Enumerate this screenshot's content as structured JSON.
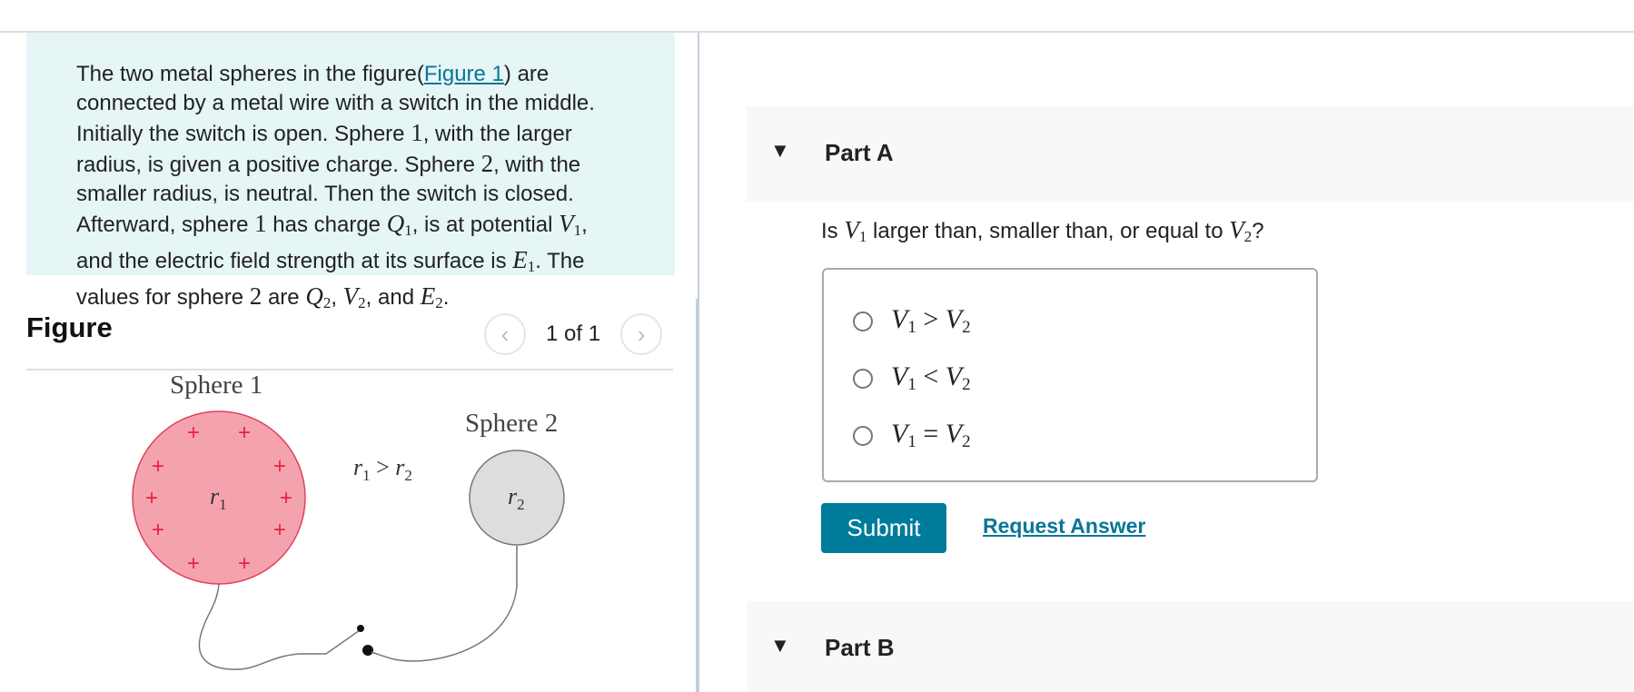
{
  "problem": {
    "lines": [
      {
        "pre": "The two metal spheres in the figure(",
        "link": "Figure 1",
        "post": ") are"
      },
      {
        "text": "connected by a metal wire with a switch in the middle."
      },
      {
        "text_a": "Initially the switch is open. Sphere ",
        "num": "1",
        "text_b": ", with the larger"
      },
      {
        "text_a": "radius, is given a positive charge. Sphere ",
        "num": "2",
        "text_b": ", with the"
      },
      {
        "text": "smaller radius, is neutral. Then the switch is closed."
      },
      {
        "a": "Afterward, sphere ",
        "n1": "1",
        "b": " has charge ",
        "q": "Q",
        "qs": "1",
        "c": ", is at potential ",
        "v": "V",
        "vs": "1",
        "d": ","
      },
      {
        "a": "and the electric field strength at its surface is ",
        "e": "E",
        "es": "1",
        "b": ". The"
      },
      {
        "a": "values for sphere ",
        "n": "2",
        "b": " are ",
        "q": "Q",
        "qs": "2",
        "c": ", ",
        "v": "V",
        "vs": "2",
        "d": ", and ",
        "e": "E",
        "es": "2",
        "f": "."
      }
    ]
  },
  "figure": {
    "heading": "Figure",
    "pager": {
      "current_label": "1 of 1",
      "prev_icon": "chevron-left-icon",
      "next_icon": "chevron-right-icon"
    },
    "diagram": {
      "sphere1_label": "Sphere 1",
      "sphere2_label": "Sphere 2",
      "r1_label": "r",
      "r1_sub": "1",
      "r2_label": "r",
      "r2_sub": "2",
      "relation": {
        "a": "r",
        "as": "1",
        "op": " > ",
        "b": "r",
        "bs": "2"
      },
      "charge_symbol": "+",
      "colors": {
        "sphere1_fill": "#f4a3ae",
        "sphere1_stroke": "#e0405a",
        "plus": "#e8203e",
        "sphere2_fill": "#dddddd",
        "sphere2_stroke": "#777777",
        "wire": "#777777"
      }
    }
  },
  "partA": {
    "title": "Part A",
    "question": {
      "a": "Is ",
      "v1": "V",
      "v1s": "1",
      "b": " larger than, smaller than, or equal to ",
      "v2": "V",
      "v2s": "2",
      "c": "?"
    },
    "options": [
      {
        "l": "V",
        "ls": "1",
        "op": " > ",
        "r": "V",
        "rs": "2",
        "selected": false
      },
      {
        "l": "V",
        "ls": "1",
        "op": " < ",
        "r": "V",
        "rs": "2",
        "selected": false
      },
      {
        "l": "V",
        "ls": "1",
        "op": " = ",
        "r": "V",
        "rs": "2",
        "selected": false
      }
    ],
    "submit_label": "Submit",
    "request_answer_label": "Request Answer"
  },
  "partB": {
    "title": "Part B"
  },
  "colors": {
    "accent": "#007c9b",
    "link": "#0a7697",
    "problem_bg": "#e6f5f6",
    "part_bg": "#f8f8f8"
  }
}
